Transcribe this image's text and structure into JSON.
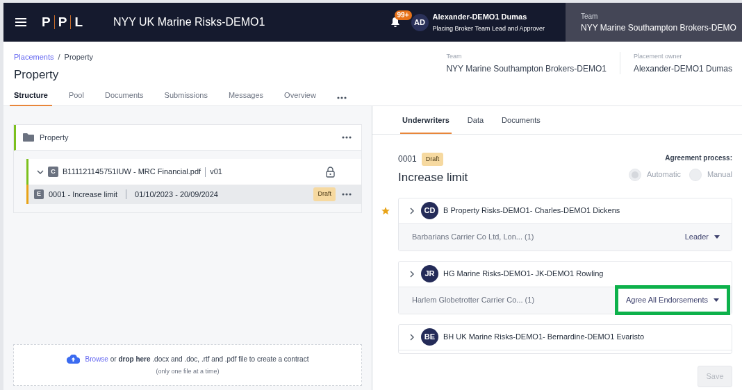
{
  "header": {
    "logo": [
      "P",
      "P",
      "L"
    ],
    "title": "NYY UK Marine Risks-DEMO1",
    "notifications": "99+",
    "user": {
      "initials": "AD",
      "name": "Alexander-DEMO1 Dumas",
      "role": "Placing Broker Team Lead and Approver"
    },
    "team": {
      "label": "Team",
      "value": "NYY Marine Southampton Brokers-DEMO"
    }
  },
  "breadcrumb_separator": "/",
  "breadcrumb": [
    {
      "label": "Placements",
      "kind": "link"
    },
    {
      "label": "Property",
      "kind": "current"
    }
  ],
  "page_title": "Property",
  "meta": [
    {
      "label": "Team",
      "value": "NYY Marine Southampton Brokers-DEMO1"
    },
    {
      "label": "Placement owner",
      "value": "Alexander-DEMO1 Dumas"
    }
  ],
  "tabs": [
    {
      "label": "Structure",
      "selected": true
    },
    {
      "label": "Pool",
      "selected": false
    },
    {
      "label": "Documents",
      "selected": false
    },
    {
      "label": "Submissions",
      "selected": false
    },
    {
      "label": "Messages",
      "selected": false
    },
    {
      "label": "Overview",
      "selected": false
    }
  ],
  "tree": {
    "folder": "Property",
    "contract": {
      "letter": "C",
      "name": "B111121145751IUW - MRC Financial.pdf",
      "version": "v01",
      "locked": true,
      "expanded": true
    },
    "endorsement": {
      "letter": "E",
      "name": "0001 - Increase limit",
      "dates": "01/10/2023 - 20/09/2024",
      "status": "Draft",
      "selected": true
    }
  },
  "upload": {
    "link": "Browse",
    "text": " or **drop here** .docx and .doc, .rtf and .pdf file to create a contract",
    "note": "(only one file at a time)"
  },
  "detail_tabs": [
    {
      "label": "Underwriters",
      "selected": true
    },
    {
      "label": "Data",
      "selected": false
    },
    {
      "label": "Documents",
      "selected": false
    }
  ],
  "endorsement": {
    "number": "0001",
    "status": "Draft",
    "title": "Increase limit"
  },
  "agreement": {
    "label": "Agreement process:",
    "options": [
      {
        "label": "Automatic",
        "selected": true
      },
      {
        "label": "Manual",
        "selected": false
      }
    ]
  },
  "underwriters": [
    {
      "initials": "CD",
      "name": "B Property Risks-DEMO1- Charles-DEMO1 Dickens",
      "lead": true,
      "carrier": "Barbarians Carrier Co Ltd, Lon... (1)",
      "action": "Leader",
      "highlighted": false
    },
    {
      "initials": "JR",
      "name": "HG Marine Risks-DEMO1- JK-DEMO1 Rowling",
      "lead": false,
      "carrier": "Harlem Globetrotter Carrier Co... (1)",
      "action": "Agree All Endorsements",
      "highlighted": true
    },
    {
      "initials": "BE",
      "name": "BH UK Marine Risks-DEMO1- Bernardine-DEMO1 Evaristo",
      "lead": false
    }
  ],
  "save": {
    "label": "Save",
    "disabled": true
  }
}
